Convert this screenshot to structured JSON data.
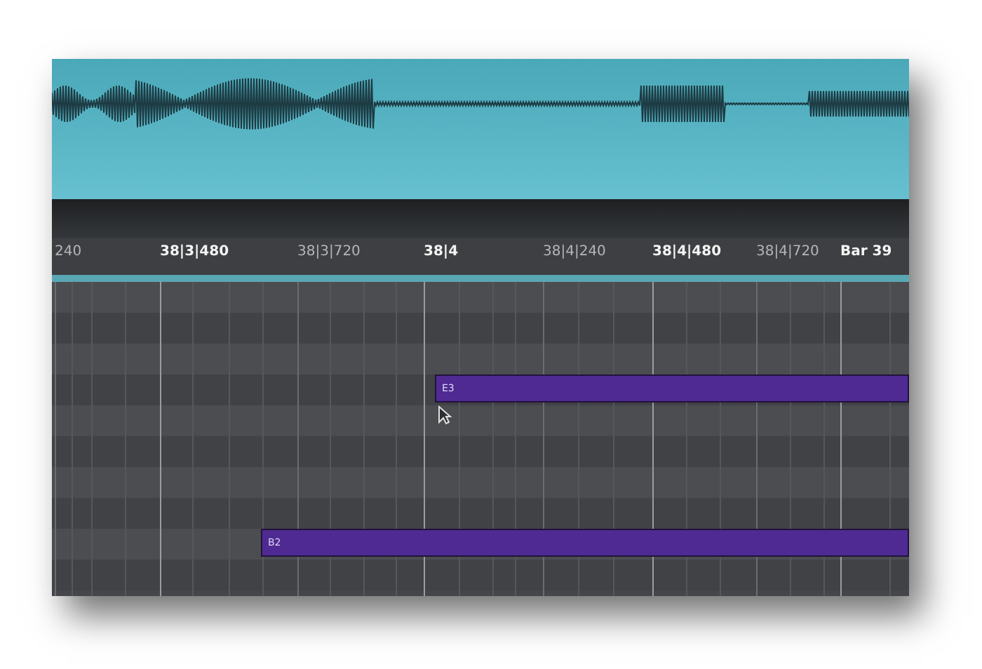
{
  "ruler": {
    "labels": [
      {
        "text": "240",
        "kind": "minor"
      },
      {
        "text": "38|3|480",
        "kind": "major"
      },
      {
        "text": "38|3|720",
        "kind": "minor"
      },
      {
        "text": "38|4",
        "kind": "major"
      },
      {
        "text": "38|4|240",
        "kind": "minor"
      },
      {
        "text": "38|4|480",
        "kind": "major"
      },
      {
        "text": "38|4|720",
        "kind": "minor"
      },
      {
        "text": "Bar 39",
        "kind": "major"
      }
    ]
  },
  "notes": [
    {
      "label": "E3"
    },
    {
      "label": "B2"
    }
  ]
}
